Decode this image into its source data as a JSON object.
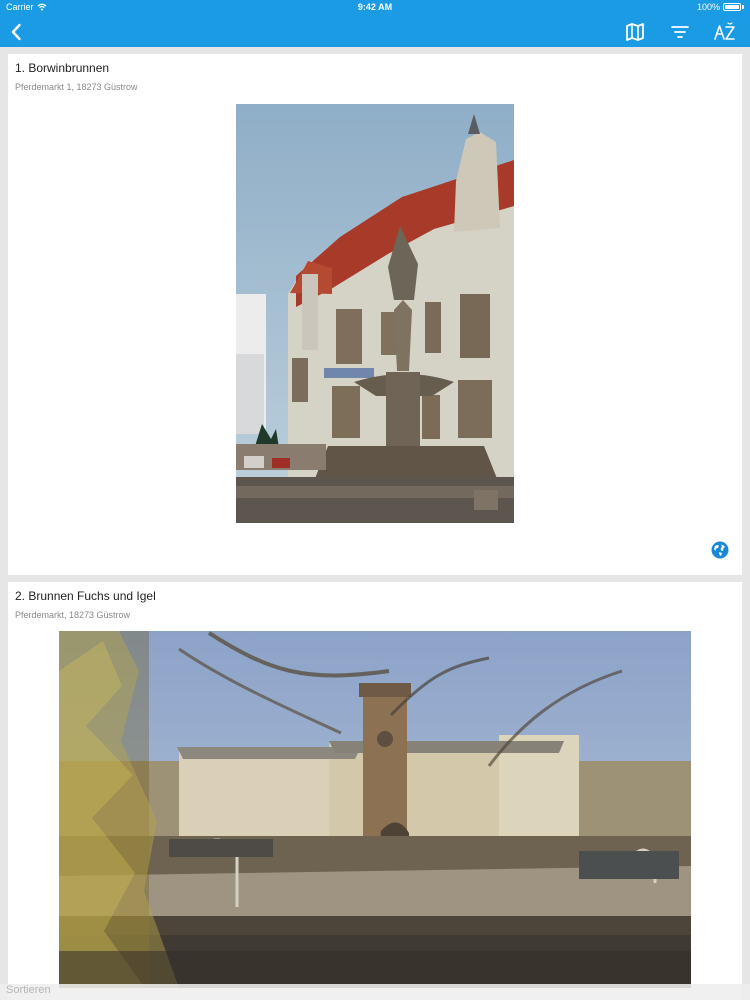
{
  "status_bar": {
    "carrier": "Carrier",
    "time": "9:42 AM",
    "battery": "100%"
  },
  "nav": {
    "back_icon": "chevron-left-icon",
    "map_icon": "map-icon",
    "filter_icon": "filter-icon",
    "sort_icon": "alphabetical-sort-icon"
  },
  "list": {
    "items": [
      {
        "title": "1. Borwinbrunnen",
        "address": "Pferdemarkt 1, 18273 Güstrow",
        "link_icon": "globe-icon"
      },
      {
        "title": "2. Brunnen Fuchs und Igel",
        "address": "Pferdemarkt, 18273 Güstrow"
      }
    ]
  },
  "footer": {
    "sort_label": "Sortieren"
  },
  "colors": {
    "accent": "#1a9be3",
    "background": "#e6e6e6",
    "card": "#ffffff",
    "link": "#1989d6"
  }
}
